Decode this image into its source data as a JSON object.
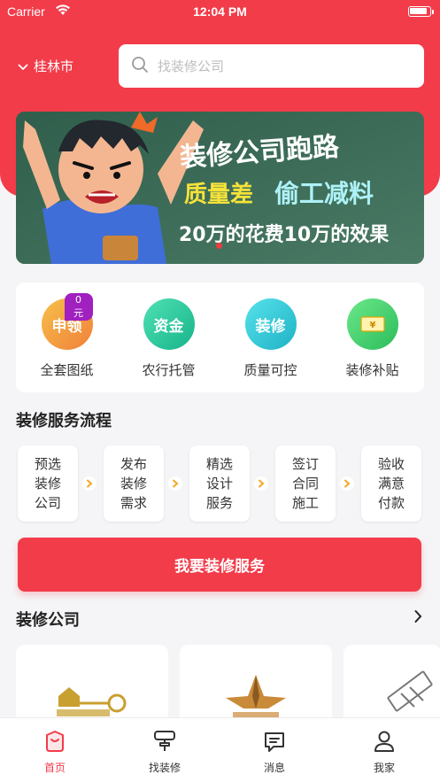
{
  "status_bar": {
    "carrier": "Carrier",
    "time": "12:04 PM"
  },
  "header": {
    "location": "桂林市",
    "search": {
      "placeholder": "找装修公司",
      "value": ""
    }
  },
  "banner": {
    "line1": "装修公司跑路",
    "line2a": "质量差",
    "line2b": "偷工减料",
    "line3": "20万的花费10万的效果"
  },
  "quick_actions": [
    {
      "label": "全套图纸",
      "icon_text": "申领",
      "badge": "0元",
      "icon": "apply-icon",
      "color": "#f5a030"
    },
    {
      "label": "农行托管",
      "icon_text": "资金",
      "icon": "fund-icon",
      "color": "#23c39a"
    },
    {
      "label": "质量可控",
      "icon_text": "装修",
      "icon": "renovation-icon",
      "color": "#28c5d2"
    },
    {
      "label": "装修补贴",
      "icon_text": "",
      "icon": "subsidy-ticket-icon",
      "color": "#3fcf6a"
    }
  ],
  "process": {
    "title": "装修服务流程",
    "steps": [
      "预选装修公司",
      "发布装修需求",
      "精选设计服务",
      "签订合同施工",
      "验收满意付款"
    ]
  },
  "cta": {
    "label": "我要装修服务"
  },
  "companies": {
    "title": "装修公司"
  },
  "tabbar": {
    "items": [
      {
        "label": "首页",
        "icon": "home-icon",
        "active": true
      },
      {
        "label": "找装修",
        "icon": "paint-roller-icon",
        "active": false
      },
      {
        "label": "消息",
        "icon": "message-icon",
        "active": false
      },
      {
        "label": "我家",
        "icon": "user-icon",
        "active": false
      }
    ]
  },
  "colors": {
    "accent": "#f23c4a",
    "background": "#f5f5f7"
  }
}
